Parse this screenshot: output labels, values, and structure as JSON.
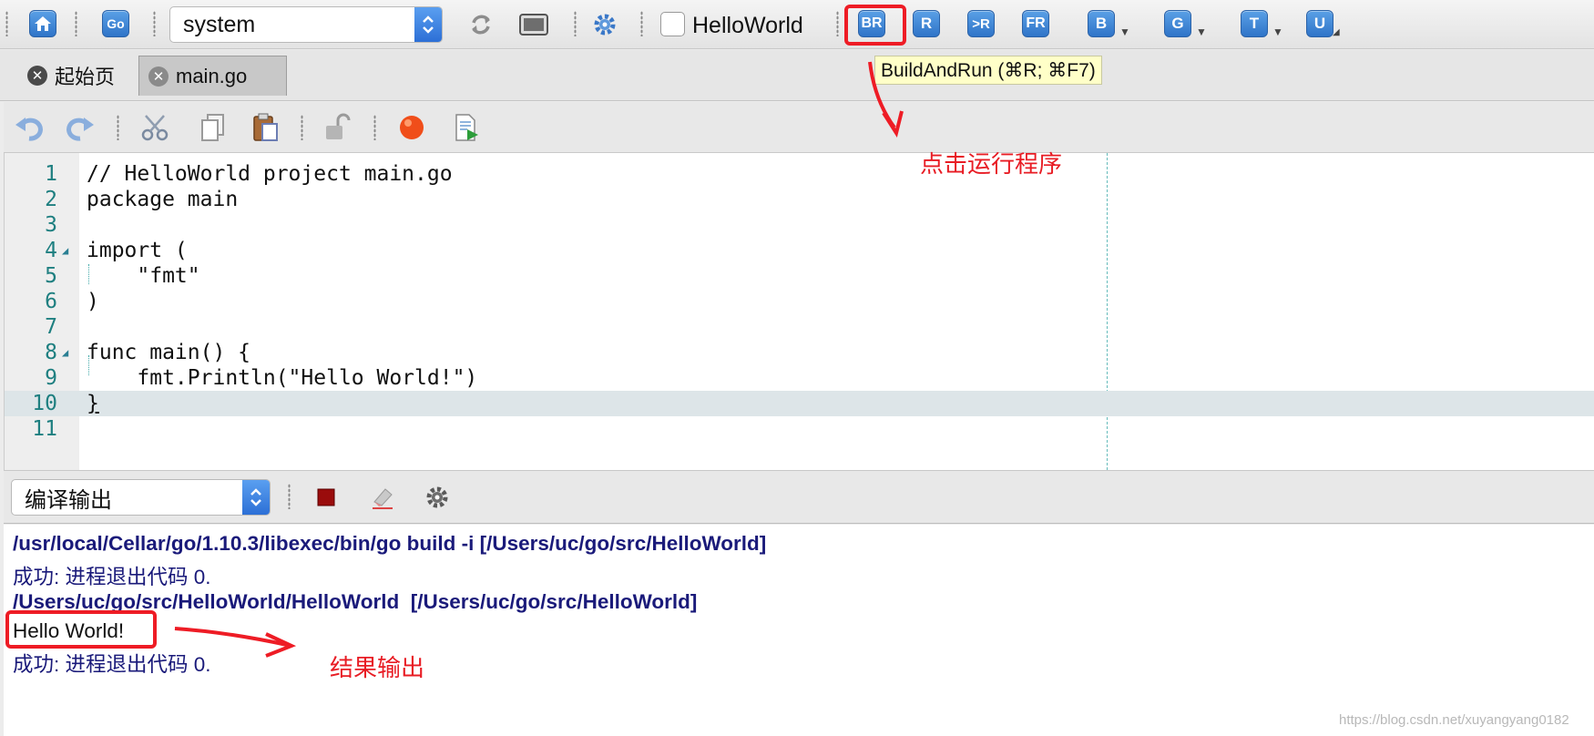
{
  "toolbar": {
    "env_select": {
      "value": "system"
    },
    "project_checkbox": {
      "label": "HelloWorld",
      "checked": false
    },
    "build_buttons": [
      {
        "label": "BR",
        "highlighted": true
      },
      {
        "label": "R"
      },
      {
        "label": ">R"
      },
      {
        "label": "FR"
      },
      {
        "label": "B",
        "has_dropdown": true
      },
      {
        "label": "G",
        "has_dropdown": true
      },
      {
        "label": "T",
        "has_dropdown": true
      },
      {
        "label": "U",
        "has_dropdown": true
      }
    ],
    "go_label": "Go"
  },
  "tabs": [
    {
      "label": "起始页",
      "active": false
    },
    {
      "label": "main.go",
      "active": true
    }
  ],
  "tooltip": {
    "text": "BuildAndRun (⌘R; ⌘F7)"
  },
  "editor": {
    "lines": [
      {
        "num": "1",
        "code": "// HelloWorld project main.go"
      },
      {
        "num": "2",
        "code": "package main"
      },
      {
        "num": "3",
        "code": ""
      },
      {
        "num": "4",
        "code": "import (",
        "fold": true
      },
      {
        "num": "5",
        "code": "    \"fmt\""
      },
      {
        "num": "6",
        "code": ")"
      },
      {
        "num": "7",
        "code": ""
      },
      {
        "num": "8",
        "code": "func main() {",
        "fold": true
      },
      {
        "num": "9",
        "code": "    fmt.Println(\"Hello World!\")"
      },
      {
        "num": "10",
        "code": "}",
        "current": true
      },
      {
        "num": "11",
        "code": ""
      }
    ]
  },
  "output_panel": {
    "select": {
      "value": "编译输出"
    },
    "lines": [
      {
        "text": "/usr/local/Cellar/go/1.10.3/libexec/bin/go build -i [/Users/uc/go/src/HelloWorld]",
        "style": "bold"
      },
      {
        "text": "成功: 进程退出代码 0.",
        "style": "normal"
      },
      {
        "text": "/Users/uc/go/src/HelloWorld/HelloWorld  [/Users/uc/go/src/HelloWorld]",
        "style": "bold"
      },
      {
        "text": "Hello World!",
        "style": "plain"
      },
      {
        "text": "成功: 进程退出代码 0.",
        "style": "normal"
      }
    ]
  },
  "annotations": {
    "run_hint": "点击运行程序",
    "result_hint": "结果输出",
    "accent_color": "#ee1c25"
  },
  "watermark": "https://blog.csdn.net/xuyangyang0182"
}
